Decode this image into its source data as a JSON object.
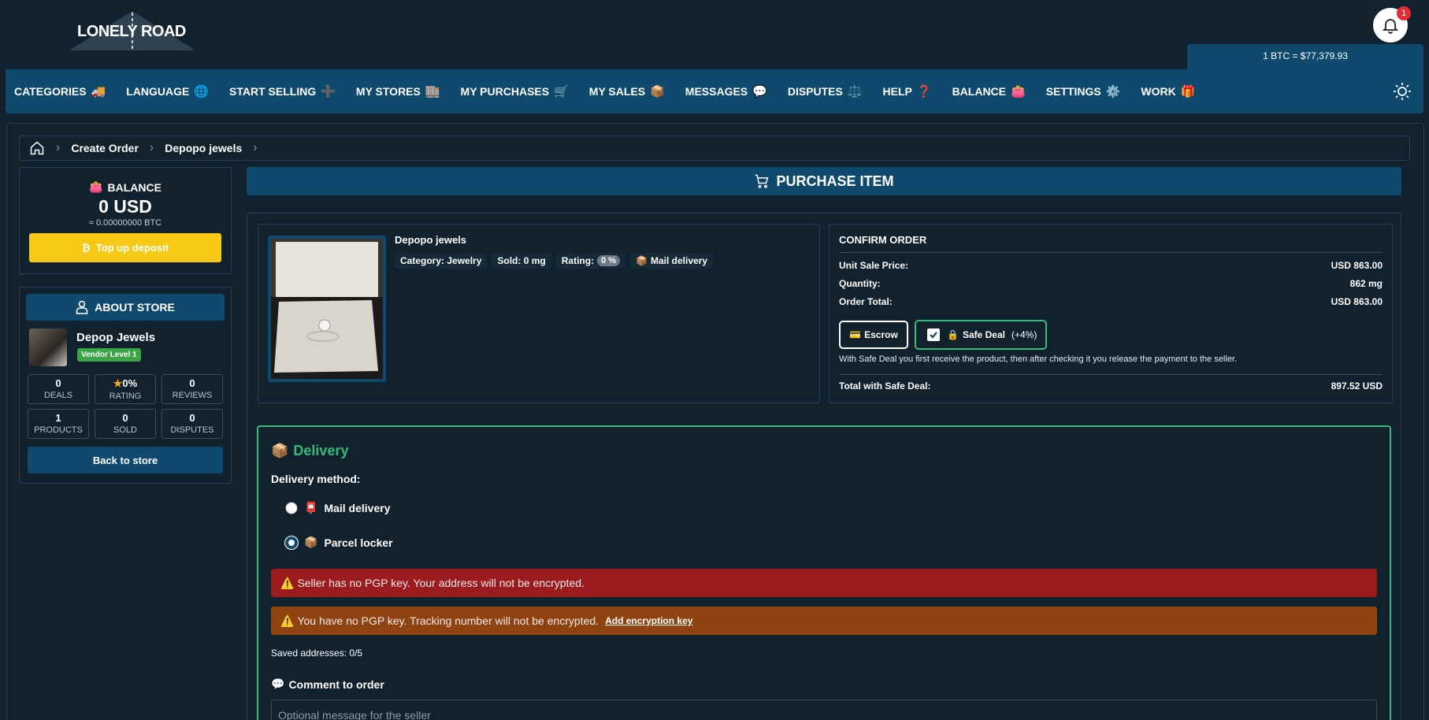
{
  "header": {
    "logo_text": "LONELY ROAD",
    "notification_count": "1",
    "btc_rate": "1 BTC = $77,379.93"
  },
  "nav": {
    "items": [
      {
        "label": "CATEGORIES",
        "icon": "🚚"
      },
      {
        "label": "LANGUAGE",
        "icon": "🌐"
      },
      {
        "label": "START SELLING",
        "icon": "➕"
      },
      {
        "label": "MY STORES",
        "icon": "🏬"
      },
      {
        "label": "MY PURCHASES",
        "icon": "🛒"
      },
      {
        "label": "MY SALES",
        "icon": "📦"
      },
      {
        "label": "MESSAGES",
        "icon": "💬"
      },
      {
        "label": "DISPUTES",
        "icon": "⚖️"
      },
      {
        "label": "HELP",
        "icon": "❓"
      },
      {
        "label": "BALANCE",
        "icon": "👛"
      },
      {
        "label": "SETTINGS",
        "icon": "⚙️"
      },
      {
        "label": "WORK",
        "icon": "🎁"
      }
    ]
  },
  "breadcrumb": {
    "items": [
      "Create Order",
      "Depopo jewels"
    ]
  },
  "balance": {
    "title": "BALANCE",
    "icon": "👛",
    "amount": "0 USD",
    "btc": "≈ 0.00000000 BTC",
    "topup_label": "Top up deposit",
    "topup_icon": "₿"
  },
  "store": {
    "about_label": "ABOUT STORE",
    "name": "Depop Jewels",
    "vendor_level": "Vendor Level 1",
    "stats": [
      {
        "value": "0",
        "label": "DEALS"
      },
      {
        "value": "0%",
        "label": "RATING",
        "star": "★"
      },
      {
        "value": "0",
        "label": "REVIEWS"
      },
      {
        "value": "1",
        "label": "PRODUCTS"
      },
      {
        "value": "0",
        "label": "SOLD"
      },
      {
        "value": "0",
        "label": "DISPUTES"
      }
    ],
    "back_label": "Back to store"
  },
  "purchase": {
    "header": "PURCHASE ITEM"
  },
  "product": {
    "name": "Depopo jewels",
    "category": "Category: Jewelry",
    "sold": "Sold: 0 mg",
    "rating_label": "Rating:",
    "rating_value": "0 %",
    "delivery_chip": "Mail delivery",
    "delivery_icon": "📦"
  },
  "confirm": {
    "title": "CONFIRM ORDER",
    "unit_price_label": "Unit Sale Price:",
    "unit_price": "USD 863.00",
    "quantity_label": "Quantity:",
    "quantity": "862 mg",
    "total_label": "Order Total:",
    "total": "USD 863.00",
    "escrow_label": "Escrow",
    "escrow_icon": "💳",
    "safe_label": "Safe Deal",
    "safe_pct": "(+4%)",
    "safe_icon": "🔒",
    "safe_note": "With Safe Deal you first receive the product, then after checking it you release the payment to the seller.",
    "safe_total_label": "Total with Safe Deal:",
    "safe_total": "897.52 USD"
  },
  "delivery": {
    "title": "Delivery",
    "title_icon": "📦",
    "method_label": "Delivery method:",
    "options": [
      {
        "label": "Mail delivery",
        "icon": "📮",
        "checked": false
      },
      {
        "label": "Parcel locker",
        "icon": "📦",
        "checked": true
      }
    ],
    "alert_red": "Seller has no PGP key. Your address will not be encrypted.",
    "alert_orange": "You have no PGP key. Tracking number will not be encrypted.",
    "alert_link": "Add encryption key",
    "alert_icon": "⚠️",
    "saved": "Saved addresses: 0/5",
    "comment_label": "Comment to order",
    "comment_icon": "💬",
    "comment_placeholder": "Optional message for the seller"
  },
  "colors": {
    "background": "#11222e",
    "primary": "#0f4a6e",
    "accent_yellow": "#f7c816",
    "success": "#3bb97a",
    "danger": "#9b1b1f",
    "warning": "#8f4310"
  }
}
